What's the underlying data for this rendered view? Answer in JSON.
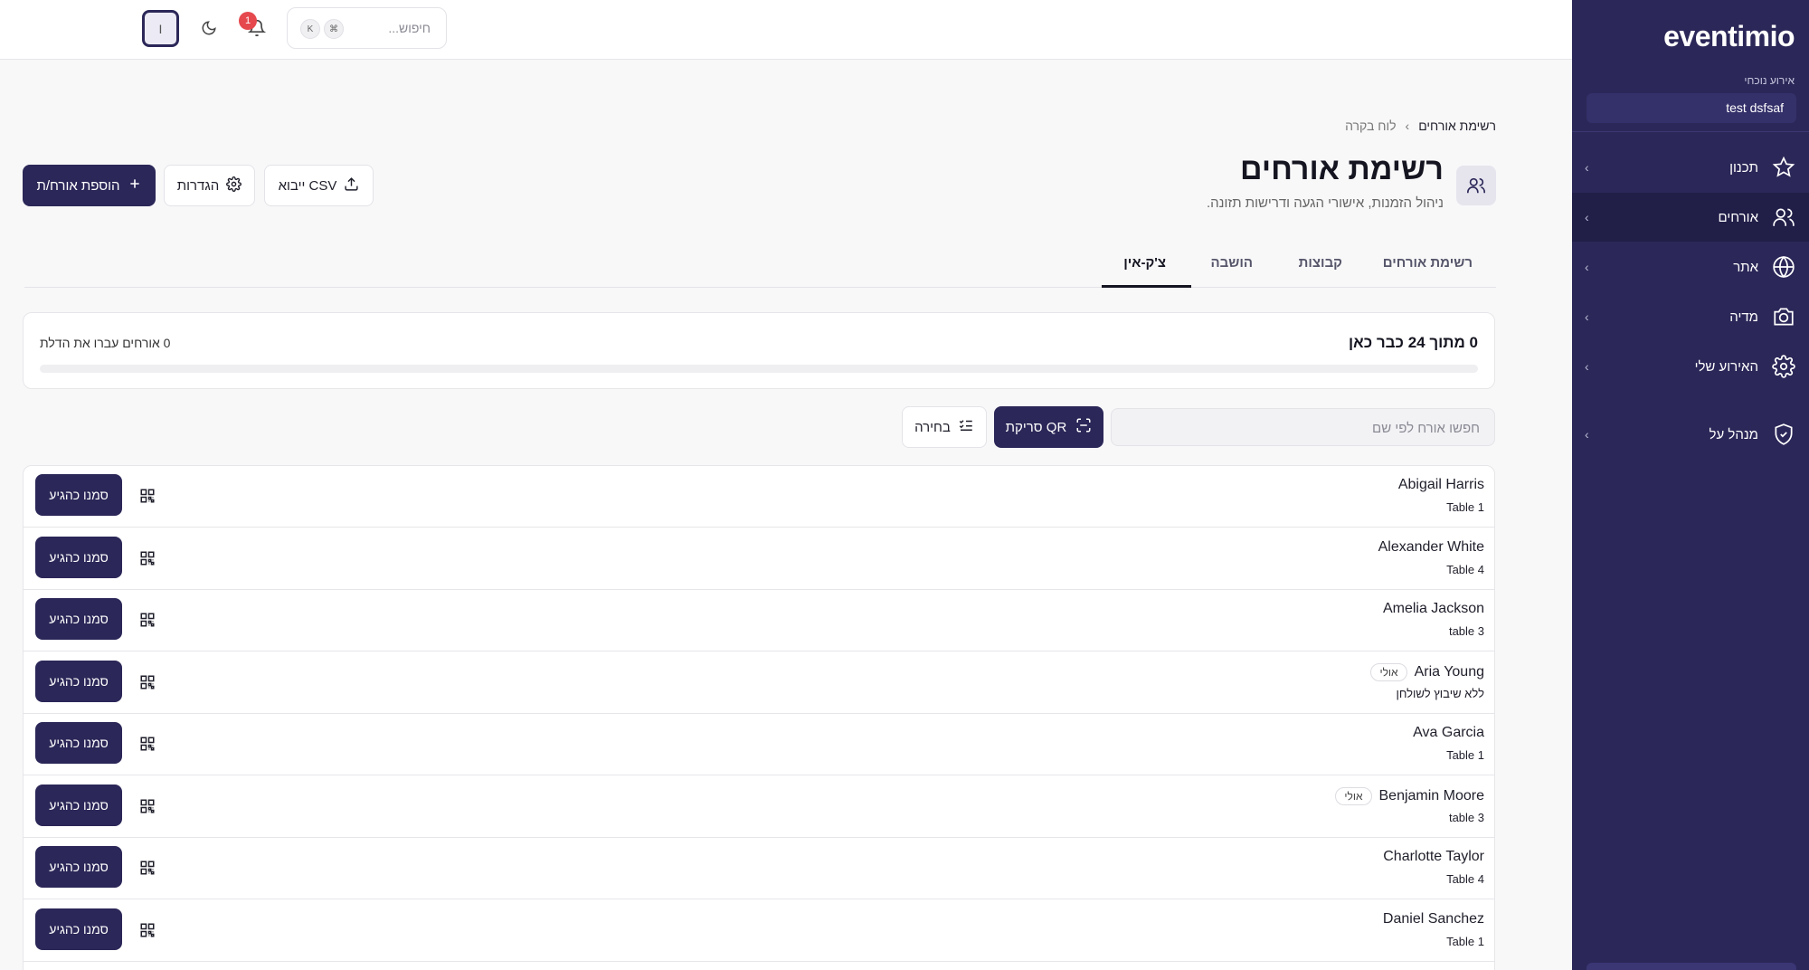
{
  "sidebar": {
    "logo": "eventimio",
    "current_event_label": "אירוע נוכחי",
    "current_event_value": "test dsfsaf",
    "items": [
      {
        "label": "תכנון",
        "icon": "star-icon"
      },
      {
        "label": "אורחים",
        "icon": "users-icon",
        "active": true
      },
      {
        "label": "אתר",
        "icon": "globe-icon"
      },
      {
        "label": "מדיה",
        "icon": "camera-icon"
      },
      {
        "label": "האירוע שלי",
        "icon": "gear-icon"
      },
      {
        "label": "מנהל על",
        "icon": "shield-icon"
      }
    ]
  },
  "topbar": {
    "search_placeholder": "חיפוש...",
    "shortcut_keys": [
      "⌘",
      "K"
    ],
    "notification_count": "1",
    "avatar_initial": "I"
  },
  "breadcrumb": {
    "parent": "לוח בקרה",
    "current": "רשימת אורחים"
  },
  "page": {
    "title": "רשימת אורחים",
    "subtitle": "ניהול הזמנות, אישורי הגעה ודרישות תזונה."
  },
  "actions": {
    "import_csv": "ייבוא CSV",
    "settings": "הגדרות",
    "add_guest": "הוספת אורח/ת"
  },
  "tabs": [
    {
      "label": "רשימת אורחים"
    },
    {
      "label": "קבוצות"
    },
    {
      "label": "הושבה"
    },
    {
      "label": "צ'ק-אין",
      "active": true
    }
  ],
  "checkin_summary": {
    "title": "0 מתוך 24 כבר כאן",
    "through_door": "0 אורחים עברו את הדלת",
    "progress": 0
  },
  "guest_search_placeholder": "חפשו אורח לפי שם",
  "qr_scan_button": "סריקת QR",
  "select_button": "בחירה",
  "mark_arrived_label": "סמנו כהגיע",
  "guests": [
    {
      "name": "Abigail Harris",
      "table": "Table 1",
      "badge": ""
    },
    {
      "name": "Alexander White",
      "table": "Table 4",
      "badge": ""
    },
    {
      "name": "Amelia Jackson",
      "table": "table 3",
      "badge": ""
    },
    {
      "name": "Aria Young",
      "table": "ללא שיבוץ לשולחן",
      "badge": "אולי"
    },
    {
      "name": "Ava Garcia",
      "table": "Table 1",
      "badge": ""
    },
    {
      "name": "Benjamin Moore",
      "table": "table 3",
      "badge": "אולי"
    },
    {
      "name": "Charlotte Taylor",
      "table": "Table 4",
      "badge": ""
    },
    {
      "name": "Daniel Sanchez",
      "table": "Table 1",
      "badge": ""
    }
  ],
  "colors": {
    "brand": "#2b2758",
    "sidebar_active": "#211e48",
    "badge_red": "#e5484d"
  }
}
